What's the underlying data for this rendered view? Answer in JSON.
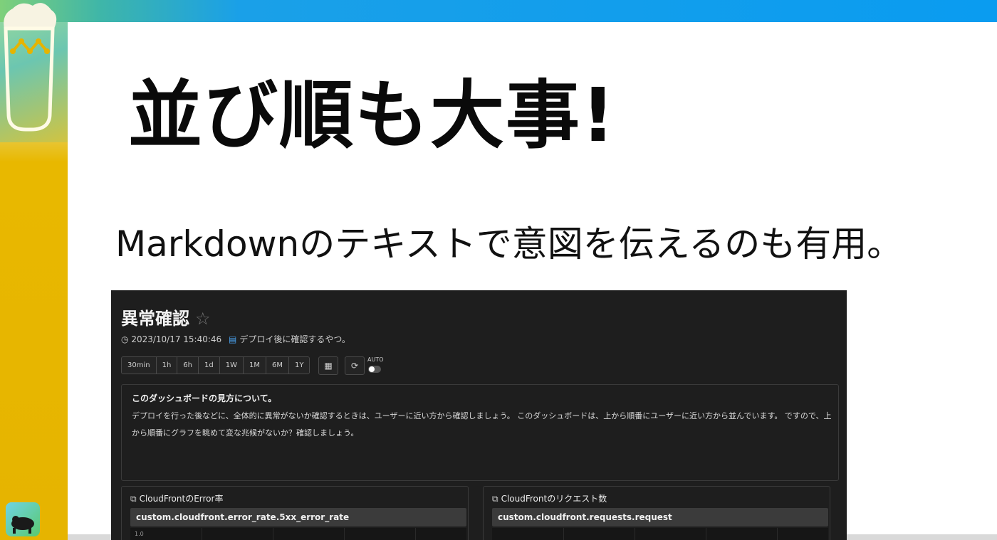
{
  "slide": {
    "title": "並び順も大事!",
    "subtitle": "Markdownのテキストで意図を伝えるのも有用。",
    "colors": {
      "top_bar": "#0a9cf0",
      "left_bar": "#e6b400",
      "title_text": "#0a0a0a"
    },
    "icons": [
      "beer-glass-icon",
      "logo-icon"
    ]
  },
  "dashboard": {
    "title": "異常確認",
    "star_icon": "☆",
    "timestamp": "2023/10/17 15:40:46",
    "note": "デプロイ後に確認するやつ。",
    "time_ranges": [
      "30min",
      "1h",
      "6h",
      "1d",
      "1W",
      "1M",
      "6M",
      "1Y"
    ],
    "calendar_icon": "📅",
    "refresh_icon": "⟳",
    "auto_label": "AUTO",
    "auto_enabled": false,
    "markdown": {
      "heading": "このダッシュボードの見方について。",
      "body": "デプロイを行った後などに、全体的に異常がないか確認するときは、ユーザーに近い方から確認しましょう。 このダッシュボードは、上から順番にユーザーに近い方から並んでいます。 ですので、上から順番にグラフを眺めて変な兆候がないか？確認しましょう。"
    },
    "panels": [
      {
        "title": "CloudFrontのError率",
        "metric": "custom.cloudfront.error_rate.5xx_error_rate",
        "ytick": "1.0"
      },
      {
        "title": "CloudFrontのリクエスト数",
        "metric": "custom.cloudfront.requests.request",
        "ytick": ""
      }
    ]
  }
}
